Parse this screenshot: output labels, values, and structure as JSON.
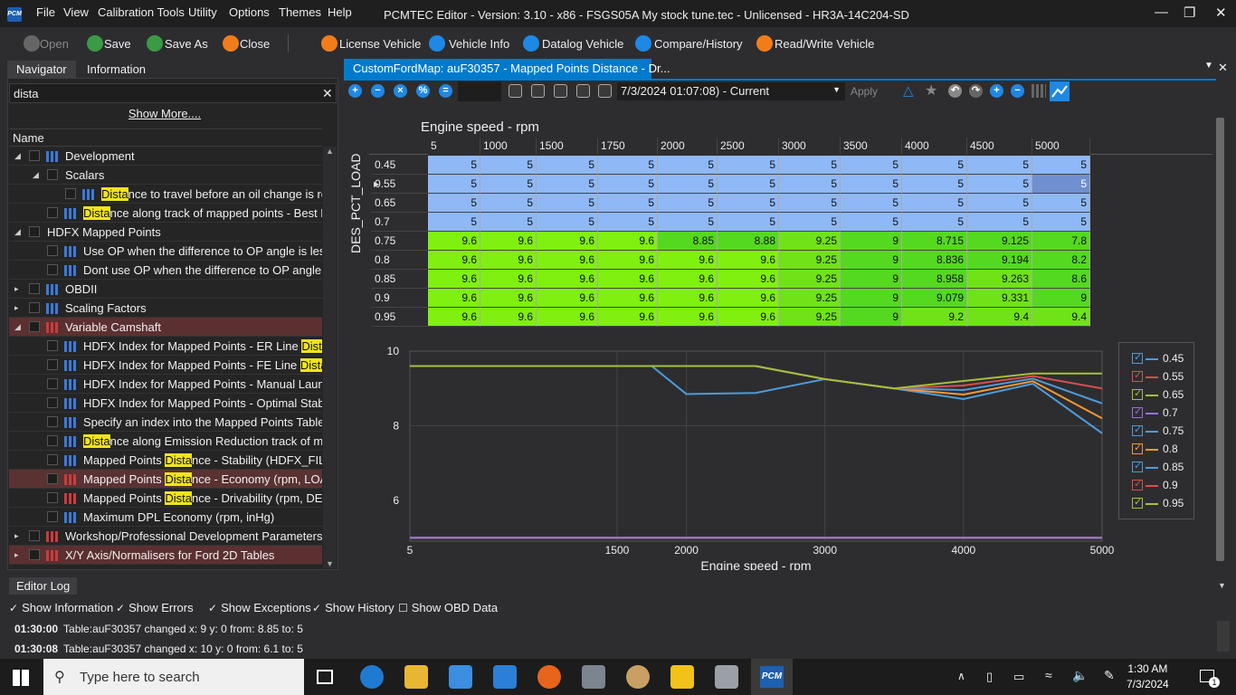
{
  "app": {
    "title": "PCMTEC Editor - Version: 3.10 - x86 - FSGS05A My stock tune.tec - Unlicensed - HR3A-14C204-SD",
    "logo": "PCM"
  },
  "menu": [
    "File",
    "View",
    "Calibration Tools",
    "Utility",
    "Options",
    "Themes",
    "Help"
  ],
  "toolbar": {
    "open": "Open",
    "save": "Save",
    "save_as": "Save As",
    "close": "Close",
    "license": "License Vehicle",
    "vehicle_info": "Vehicle Info",
    "datalog": "Datalog Vehicle",
    "compare": "Compare/History",
    "read_write": "Read/Write Vehicle"
  },
  "nav": {
    "tabs": [
      "Navigator",
      "Information"
    ],
    "search_value": "dista",
    "show_more": "Show More....",
    "name_header": "Name",
    "items": [
      {
        "pre": "Development",
        "mark": "",
        "post": ""
      },
      {
        "pre": "Scalars",
        "mark": "",
        "post": ""
      },
      {
        "pre": "",
        "mark": "Dista",
        "post": "nce to travel before an oil change is re..."
      },
      {
        "pre": "",
        "mark": "Dista",
        "post": "nce along track of mapped points - Best F..."
      },
      {
        "pre": "HDFX Mapped Points",
        "mark": "",
        "post": ""
      },
      {
        "pre": "Use OP when the difference to OP angle is less...",
        "mark": "",
        "post": ""
      },
      {
        "pre": "Dont use OP when the difference to OP angle i...",
        "mark": "",
        "post": ""
      },
      {
        "pre": "OBDII",
        "mark": "",
        "post": ""
      },
      {
        "pre": "Scaling Factors",
        "mark": "",
        "post": ""
      },
      {
        "pre": "Variable Camshaft",
        "mark": "",
        "post": ""
      },
      {
        "pre": "HDFX Index for Mapped Points - ER Line ",
        "mark": "Dista",
        "post": "n..."
      },
      {
        "pre": "HDFX Index for Mapped Points - FE Line ",
        "mark": "Dista",
        "post": "n..."
      },
      {
        "pre": "HDFX Index for Mapped Points - Manual Launc...",
        "mark": "",
        "post": ""
      },
      {
        "pre": "HDFX Index for Mapped Points - Optimal Stabil...",
        "mark": "",
        "post": ""
      },
      {
        "pre": "Specify an index into the  Mapped Points Table...",
        "mark": "",
        "post": ""
      },
      {
        "pre": " ",
        "mark": "Dista",
        "post": "nce  along Emission Reduction track of m..."
      },
      {
        "pre": "Mapped Points ",
        "mark": "Dista",
        "post": "nce - Stability (HDFX_FILT_..."
      },
      {
        "pre": "Mapped Points ",
        "mark": "Dista",
        "post": "nce - Economy (rpm, LOA..."
      },
      {
        "pre": "Mapped Points ",
        "mark": "Dista",
        "post": "nce - Drivability (rpm, DES..."
      },
      {
        "pre": "Maximum DPL Economy (rpm, inHg)",
        "mark": "",
        "post": ""
      },
      {
        "pre": "Workshop/Professional Development Parameters",
        "mark": "",
        "post": ""
      },
      {
        "pre": "X/Y Axis/Normalisers for Ford 2D Tables",
        "mark": "",
        "post": ""
      }
    ]
  },
  "editor": {
    "doc_tab": "CustomFordMap: auF30357 - Mapped Points Distance - Dr...",
    "date_select": "7/3/2024 01:07:08) - Current",
    "apply": "Apply",
    "x_axis_label": "Engine speed - rpm",
    "y_axis_label": "DES_PCT_LOAD"
  },
  "chart_data": {
    "type": "table",
    "x": [
      "5",
      "1000",
      "1500",
      "1750",
      "2000",
      "2500",
      "3000",
      "3500",
      "4000",
      "4500",
      "5000"
    ],
    "y": [
      "0.45",
      "0.55",
      "0.65",
      "0.7",
      "0.75",
      "0.8",
      "0.85",
      "0.9",
      "0.95"
    ],
    "values": [
      [
        "5",
        "5",
        "5",
        "5",
        "5",
        "5",
        "5",
        "5",
        "5",
        "5",
        "5"
      ],
      [
        "5",
        "5",
        "5",
        "5",
        "5",
        "5",
        "5",
        "5",
        "5",
        "5",
        "5"
      ],
      [
        "5",
        "5",
        "5",
        "5",
        "5",
        "5",
        "5",
        "5",
        "5",
        "5",
        "5"
      ],
      [
        "5",
        "5",
        "5",
        "5",
        "5",
        "5",
        "5",
        "5",
        "5",
        "5",
        "5"
      ],
      [
        "9.6",
        "9.6",
        "9.6",
        "9.6",
        "8.85",
        "8.88",
        "9.25",
        "9",
        "8.715",
        "9.125",
        "7.8"
      ],
      [
        "9.6",
        "9.6",
        "9.6",
        "9.6",
        "9.6",
        "9.6",
        "9.25",
        "9",
        "8.836",
        "9.194",
        "8.2"
      ],
      [
        "9.6",
        "9.6",
        "9.6",
        "9.6",
        "9.6",
        "9.6",
        "9.25",
        "9",
        "8.958",
        "9.263",
        "8.6"
      ],
      [
        "9.6",
        "9.6",
        "9.6",
        "9.6",
        "9.6",
        "9.6",
        "9.25",
        "9",
        "9.079",
        "9.331",
        "9"
      ],
      [
        "9.6",
        "9.6",
        "9.6",
        "9.6",
        "9.6",
        "9.6",
        "9.25",
        "9",
        "9.2",
        "9.4",
        "9.4"
      ]
    ],
    "graph": {
      "type": "line",
      "xlabel": "Engine speed - rpm",
      "x_ticks": [
        "5",
        "1500",
        "2000",
        "3000",
        "4000",
        "5000"
      ],
      "y_ticks": [
        "10",
        "8",
        "6"
      ],
      "ylim": [
        5,
        10
      ],
      "series_colors": [
        "#4e9bd8",
        "#d84e4e",
        "#a3c13a",
        "#9a6fd6",
        "#4e9bd8",
        "#f29a35",
        "#4e9bd8",
        "#d84e4e",
        "#a3c13a"
      ],
      "legend_position": "right"
    }
  },
  "log": {
    "tab": "Editor Log",
    "options": [
      "Show Information",
      "Show Errors",
      "Show Exceptions",
      "Show History",
      "Show OBD Data"
    ],
    "lines": [
      {
        "time": "01:30:00",
        "text": "Table:auF30357 changed x: 9 y: 0 from: 8.85 to: 5"
      },
      {
        "time": "01:30:08",
        "text": "Table:auF30357 changed x: 10 y: 0 from: 6.1 to: 5"
      }
    ]
  },
  "taskbar": {
    "search_placeholder": "Type here to search",
    "time": "1:30 AM",
    "date": "7/3/2024",
    "notif": "1"
  }
}
